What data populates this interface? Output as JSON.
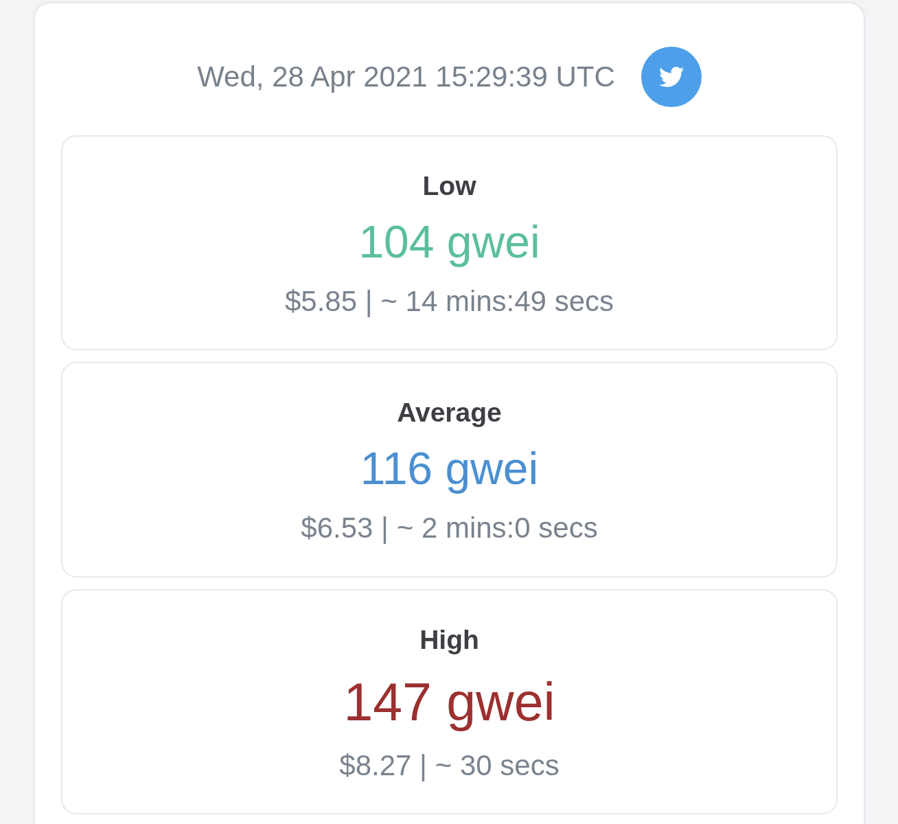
{
  "header": {
    "timestamp": "Wed, 28 Apr 2021 15:29:39 UTC"
  },
  "tiers": [
    {
      "label": "Low",
      "price": "104 gwei",
      "color": "#5bbf9d",
      "emphasized": false,
      "detail": "$5.85 | ~ 14 mins:49 secs"
    },
    {
      "label": "Average",
      "price": "116 gwei",
      "color": "#4b8fd1",
      "emphasized": false,
      "detail": "$6.53 | ~ 2 mins:0 secs"
    },
    {
      "label": "High",
      "price": "147 gwei",
      "color": "#9c3030",
      "emphasized": true,
      "detail": "$8.27 | ~ 30 secs"
    }
  ]
}
